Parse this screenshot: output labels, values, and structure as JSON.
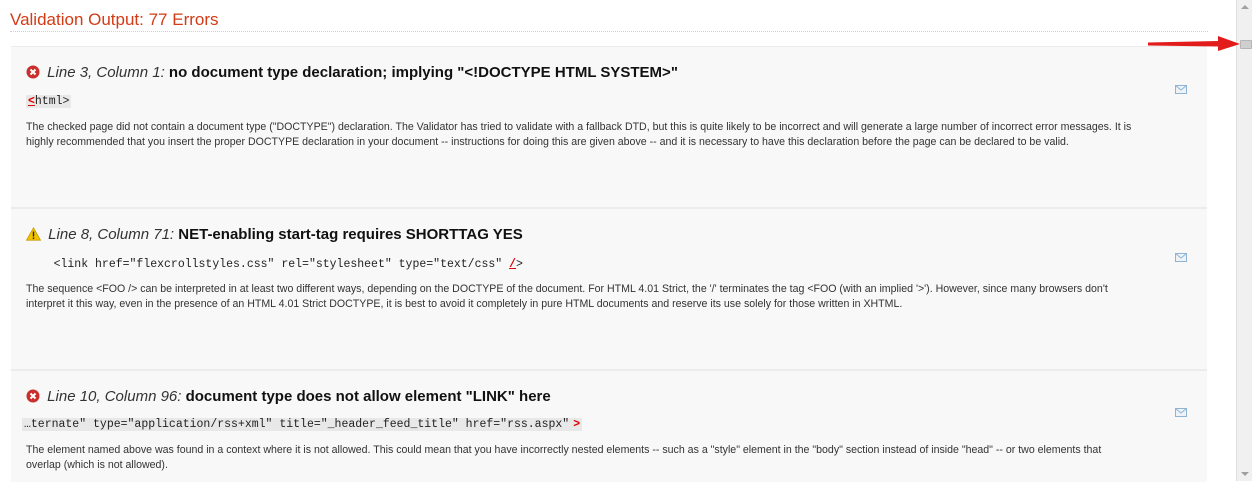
{
  "heading": "Validation Output: 77 Errors",
  "messages": [
    {
      "type": "error",
      "icon": "error-icon",
      "location": "Line 3, Column 1",
      "text": "no document type declaration; implying \"<!DOCTYPE HTML SYSTEM>\"",
      "code_before": "",
      "code_err": "<",
      "code_after": "html>",
      "description": "The checked page did not contain a document type (\"DOCTYPE\") declaration. The Validator has tried to validate with a fallback DTD, but this is quite likely to be incorrect and will generate a large number of incorrect error messages. It is highly recommended that you insert the proper DOCTYPE declaration in your document -- instructions for doing this are given above -- and it is necessary to have this declaration before the page can be declared to be valid."
    },
    {
      "type": "warning",
      "icon": "warning-icon",
      "location": "Line 8, Column 71",
      "text": "NET-enabling start-tag requires SHORTTAG YES",
      "code_before": "    <link href=\"flexcrollstyles.css\" rel=\"stylesheet\" type=\"text/css\" ",
      "code_err": "/",
      "code_after": ">",
      "description": "The sequence <FOO /> can be interpreted in at least two different ways, depending on the DOCTYPE of the document. For HTML 4.01 Strict, the '/' terminates the tag <FOO (with an implied '>'). However, since many browsers don't interpret it this way, even in the presence of an HTML 4.01 Strict DOCTYPE, it is best to avoid it completely in pure HTML documents and reserve its use solely for those written in XHTML."
    },
    {
      "type": "error",
      "icon": "error-icon",
      "location": "Line 10, Column 96",
      "text": "document type does not allow element \"LINK\" here",
      "code_before": "…ternate\" type=\"application/rss+xml\" title=\"_header_feed_title\" href=\"rss.aspx\"",
      "code_err": ">",
      "code_after": "",
      "description": "The element named above was found in a context where it is not allowed. This could mean that you have incorrectly nested elements -- such as a \"style\" element in the \"body\" section instead of inside \"head\" -- or two elements that overlap (which is not allowed)."
    }
  ],
  "colors": {
    "heading": "#d33b16",
    "error": "#d00000",
    "panel": "#f8f8f8"
  },
  "icons": {
    "feedback": "mail-icon",
    "annotation": "red-arrow-icon"
  }
}
